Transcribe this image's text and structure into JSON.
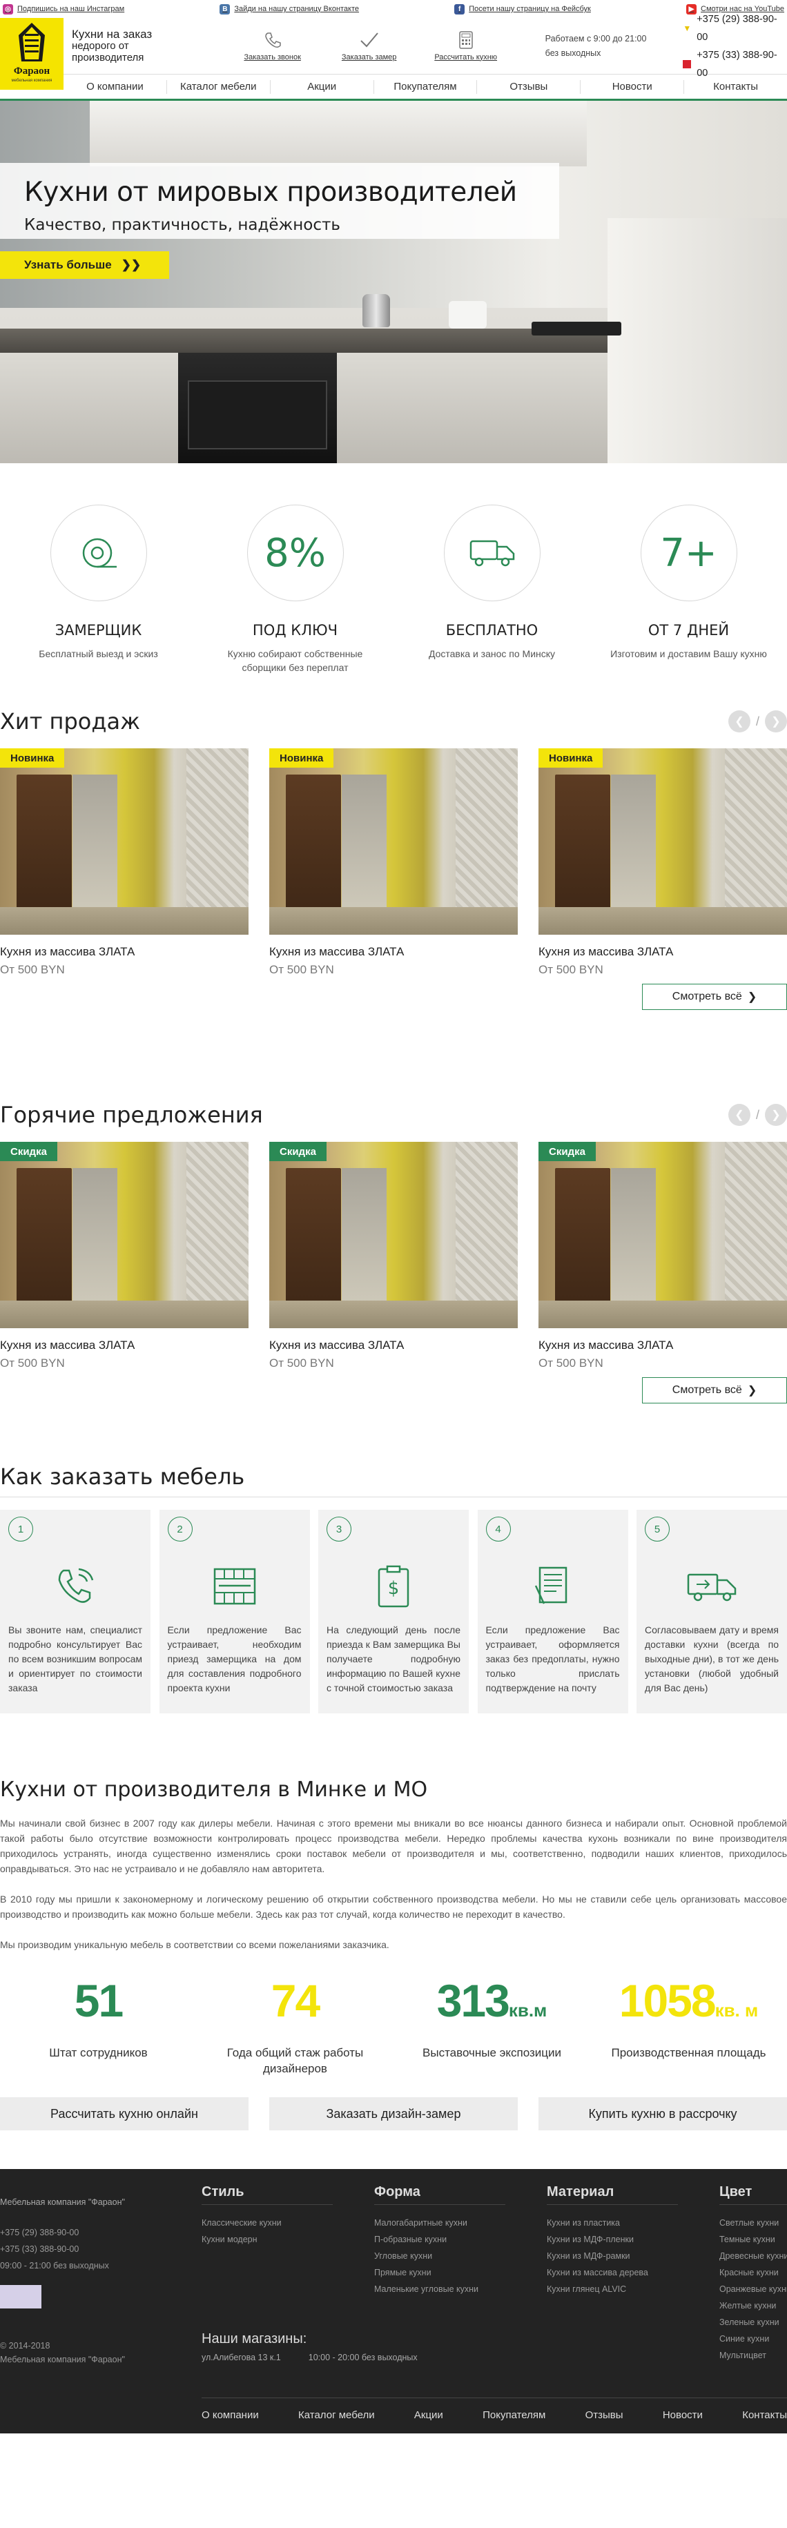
{
  "topbar": {
    "instagram": "Подпишись на наш Инстаграм",
    "vk": "Зайди на нашу страницу Вконтакте",
    "facebook": "Посети нашу страницу на Фейсбук",
    "youtube": "Смотри нас на YouTube"
  },
  "logo": {
    "name": "Фараон",
    "sub": "мебельная компания"
  },
  "header": {
    "tagline_1": "Кухни на заказ",
    "tagline_2": "недорого от производителя",
    "btn_call": "Заказать звонок",
    "btn_measure": "Заказать замер",
    "btn_calc": "Рассчитать кухню",
    "worktime_1": "Работаем с 9:00 до 21:00",
    "worktime_2": "без выходных",
    "phone_1": "+375 (29) 388-90-00",
    "phone_2": "+375 (33) 388-90-00"
  },
  "nav": [
    "О компании",
    "Каталог мебели",
    "Акции",
    "Покупателям",
    "Отзывы",
    "Новости",
    "Контакты"
  ],
  "hero": {
    "title": "Кухни от мировых производителей",
    "subtitle": "Качество, практичность, надёжность",
    "cta": "Узнать больше"
  },
  "features": [
    {
      "title": "ЗАМЕРЩИК",
      "desc": "Бесплатный выезд и эскиз"
    },
    {
      "title": "ПОД КЛЮЧ",
      "desc": "Кухню собирают собственные сборщики без переплат",
      "icon_text": "8%"
    },
    {
      "title": "БЕСПЛАТНО",
      "desc": "Доставка и занос по Минску"
    },
    {
      "title": "ОТ 7 ДНЕЙ",
      "desc": "Изготовим и доставим Вашу кухню",
      "icon_text": "7+"
    }
  ],
  "hits": {
    "title": "Хит продаж",
    "slash": "/",
    "more": "Смотреть всё",
    "items": [
      {
        "badge": "Новинка",
        "name": "Кухня из массива ЗЛАТА",
        "price": "От 500 BYN"
      },
      {
        "badge": "Новинка",
        "name": "Кухня из массива ЗЛАТА",
        "price": "От 500 BYN"
      },
      {
        "badge": "Новинка",
        "name": "Кухня из массива ЗЛАТА",
        "price": "От 500 BYN"
      }
    ]
  },
  "hot": {
    "title": "Горячие предложения",
    "slash": "/",
    "more": "Смотреть всё",
    "items": [
      {
        "badge": "Скидка",
        "name": "Кухня из массива ЗЛАТА",
        "price": "От 500 BYN"
      },
      {
        "badge": "Скидка",
        "name": "Кухня из массива ЗЛАТА",
        "price": "От 500 BYN"
      },
      {
        "badge": "Скидка",
        "name": "Кухня из массива ЗЛАТА",
        "price": "От 500 BYN"
      }
    ]
  },
  "order": {
    "title": "Как заказать мебель",
    "steps": [
      {
        "num": "1",
        "desc": "Вы звоните нам, специалист подробно консультирует Вас по всем возникшим вопросам и ориентирует по стоимости заказа"
      },
      {
        "num": "2",
        "desc": "Если предложение Вас устраивает, необходим приезд замерщика на дом для составления подробного проекта кухни"
      },
      {
        "num": "3",
        "desc": "На следующий день после приезда к Вам замерщика Вы получаете подробную информацию по Вашей кухне с точной стоимостью заказа"
      },
      {
        "num": "4",
        "desc": "Если предложение Вас устраивает, оформляется заказ без предоплаты, нужно только прислать подтверждение на почту"
      },
      {
        "num": "5",
        "desc": "Согласовываем дату и время доставки кухни (всегда по выходные дни), в тот же день установки (любой удобный для Вас день)"
      }
    ]
  },
  "about": {
    "title": "Кухни от производителя в Минке и МО",
    "p1": "Мы начинали свой бизнес в 2007 году как дилеры мебели. Начиная с этого времени мы вникали во все нюансы данного бизнеса и набирали опыт. Основной проблемой такой работы было отсутствие возможности контролировать процесс производства мебели. Нередко проблемы качества кухонь возникали по вине производителя приходилось устранять, иногда существенно изменялись сроки поставок мебели от производителя и мы, соответственно, подводили наших клиентов, приходилось оправдываться. Это нас не устраивало и не добавляло нам авторитета.",
    "p2": "В 2010 году мы пришли к закономерному и логическому решению об открытии собственного производства мебели. Но мы не ставили себе цель организовать массовое производство и производить как можно больше мебели. Здесь как раз тот случай, когда количество не переходит в качество.",
    "p3": "Мы производим уникальную мебель в соответствии со всеми пожеланиями заказчика."
  },
  "stats": [
    {
      "value": "51",
      "unit": "",
      "label": "Штат сотрудников",
      "color": "#2b8a55"
    },
    {
      "value": "74",
      "unit": "",
      "label": "Года общий стаж работы дизайнеров",
      "color": "#f3e40b"
    },
    {
      "value": "313",
      "unit": "кв.м",
      "label": "Выставочные экспозиции",
      "color": "#2b8a55"
    },
    {
      "value": "1058",
      "unit": "кв. м",
      "label": "Производственная площадь",
      "color": "#f3e40b"
    }
  ],
  "actions": {
    "calc": "Рассчитать кухню онлайн",
    "design": "Заказать дизайн-замер",
    "credit": "Купить кухню в рассрочку"
  },
  "footer": {
    "company": "Мебельная компания \"Фараон\"",
    "phone_1": "+375 (29) 388-90-00",
    "phone_2": "+375 (33) 388-90-00",
    "hours": "09:00 - 21:00 без выходных",
    "copy_1": "© 2014-2018",
    "copy_2": "Мебельная компания \"Фараон\"",
    "style": {
      "title": "Стиль",
      "items": [
        "Классические кухни",
        "Кухни модерн"
      ]
    },
    "form": {
      "title": "Форма",
      "items": [
        "Малогабаритные кухни",
        "П-образные кухни",
        "Угловые кухни",
        "Прямые кухни",
        "Маленькие угловые кухни"
      ]
    },
    "material": {
      "title": "Материал",
      "items": [
        "Кухни из пластика",
        "Кухни из МДФ-пленки",
        "Кухни из МДФ-рамки",
        "Кухни из массива дерева",
        "Кухни глянец ALVIC"
      ]
    },
    "color": {
      "title": "Цвет",
      "items": [
        "Светлые кухни",
        "Темные кухни",
        "Древесные кухни",
        "Красные кухни",
        "Оранжевые кухни",
        "Желтые кухни",
        "Зеленые кухни",
        "Синие кухни",
        "Мультицвет"
      ]
    },
    "stores_title": "Наши магазины:",
    "address": "ул.Алибегова 13 к.1",
    "store_hours": "10:00 - 20:00 без выходных"
  },
  "colors": {
    "green": "#2b8a55",
    "yellow": "#f3e40b",
    "dark": "#232323"
  }
}
